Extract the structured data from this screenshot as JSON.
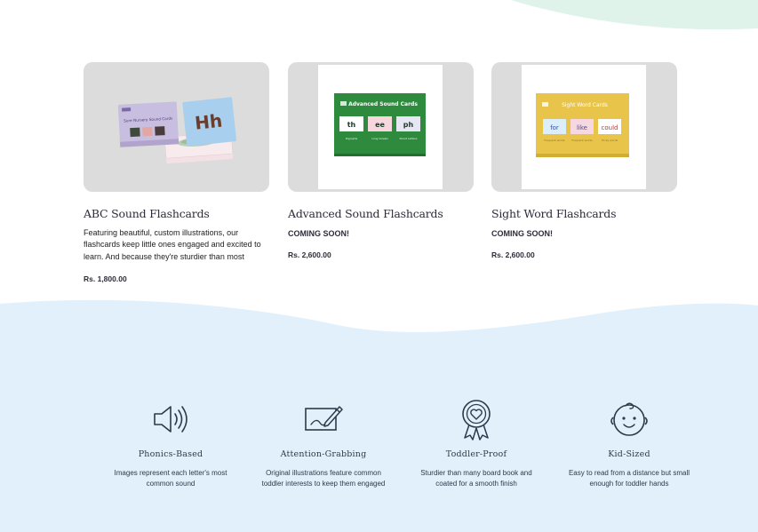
{
  "colors": {
    "top_wave": "#dff3ea",
    "features_bg": "#e1f0fb",
    "card_bg": "#dcdcdc",
    "text_dark": "#2c2c3a"
  },
  "products": [
    {
      "title": "ABC Sound Flashcards",
      "description": "Featuring beautiful, custom illustrations, our flashcards keep little ones engaged and excited to learn. And because they're sturdier than most",
      "status": "",
      "price": "Rs. 1,800.00",
      "box_title": "Sure Nursery Sound Cards",
      "box_letter": "Hh"
    },
    {
      "title": "Advanced Sound Flashcards",
      "description": "",
      "status": "COMING SOON!",
      "price": "Rs. 2,600.00",
      "box_title": "Advanced Sound Cards",
      "cards": [
        "th",
        "ee",
        "ph"
      ],
      "card_captions": [
        "Digraphs",
        "Long Vowels",
        "Silent Letters"
      ]
    },
    {
      "title": "Sight Word Flashcards",
      "description": "",
      "status": "COMING SOON!",
      "price": "Rs. 2,600.00",
      "box_title": "Sight Word Cards",
      "cards": [
        "for",
        "like",
        "could"
      ],
      "card_captions": [
        "Frequent words",
        "Frequent words",
        "Tricky words"
      ]
    }
  ],
  "features": [
    {
      "icon": "speaker-icon",
      "title": "Phonics-Based",
      "description_line1": "Images represent each letter's most",
      "description_line2": "common sound"
    },
    {
      "icon": "drawing-pen-icon",
      "title": "Attention-Grabbing",
      "description_line1": "Original illustrations feature common",
      "description_line2": "toddler interests to keep them engaged"
    },
    {
      "icon": "award-badge-icon",
      "title": "Toddler-Proof",
      "description_line1": "Sturdier than many board book and",
      "description_line2": "coated for a smooth finish"
    },
    {
      "icon": "baby-face-icon",
      "title": "Kid-Sized",
      "description_line1": "Easy to read from a distance but small",
      "description_line2": "enough for toddler hands"
    }
  ]
}
